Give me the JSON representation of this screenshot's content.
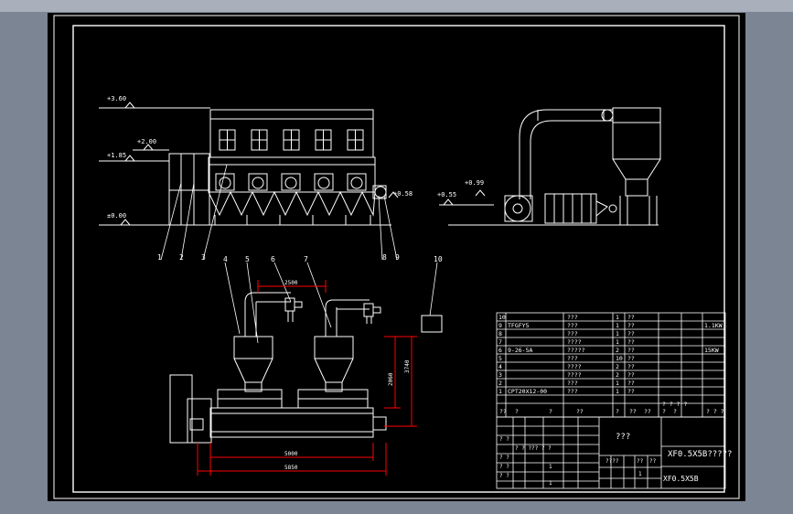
{
  "levels": {
    "l360": "+3.60",
    "l200": "+2.00",
    "l185": "+1.85",
    "l000": "±0.00",
    "l058": "+0.58",
    "l055": "+0.55",
    "l099": "+0.99"
  },
  "part_numbers": [
    "1",
    "2",
    "3",
    "4",
    "5",
    "6",
    "7",
    "8",
    "9",
    "10"
  ],
  "dimensions": {
    "top_span": "2500",
    "height_a": "3740",
    "height_b": "2060",
    "bottom_inner": "5000",
    "bottom_outer": "5850"
  },
  "parts_table": [
    {
      "no": "10",
      "code": "",
      "name": "???",
      "qty": "1",
      "mat": "??",
      "note": ""
    },
    {
      "no": "9",
      "code": "TFGFY5",
      "name": "???",
      "qty": "1",
      "mat": "??",
      "note": "1.1KW"
    },
    {
      "no": "8",
      "code": "",
      "name": "???",
      "qty": "1",
      "mat": "??",
      "note": ""
    },
    {
      "no": "7",
      "code": "",
      "name": "????",
      "qty": "1",
      "mat": "??",
      "note": ""
    },
    {
      "no": "6",
      "code": "9-26-5A",
      "name": "?????",
      "qty": "2",
      "mat": "??",
      "note": "15KW"
    },
    {
      "no": "5",
      "code": "",
      "name": "???",
      "qty": "10",
      "mat": "??",
      "note": ""
    },
    {
      "no": "4",
      "code": "",
      "name": "????",
      "qty": "2",
      "mat": "??",
      "note": ""
    },
    {
      "no": "3",
      "code": "",
      "name": "????",
      "qty": "2",
      "mat": "??",
      "note": ""
    },
    {
      "no": "2",
      "code": "",
      "name": "???",
      "qty": "1",
      "mat": "??",
      "note": ""
    },
    {
      "no": "1",
      "code": "CPT20X12-00",
      "name": "???",
      "qty": "1",
      "mat": "??",
      "note": ""
    }
  ],
  "table_header_row": [
    "??",
    "?",
    "?",
    "??",
    "?",
    "??",
    "??",
    "?",
    "?",
    "? ? ? ?",
    "? ? ?"
  ],
  "title_block": {
    "center": "???",
    "name": "XF0.5X5B?????",
    "drawing_no": "XF0.5X5B",
    "row_a": "? ?",
    "row_b": "? ? ??? ? ?",
    "row_c": "? ?",
    "row_d": "? ?",
    "row_e": "? ?",
    "cell_f": "????",
    "cell_g": "??",
    "cell_h": "??",
    "cell_i": "1",
    "cell_j": "1",
    "cell_k": "1"
  },
  "colors": {
    "background": "#7c8593",
    "sheet": "#000000",
    "line": "#ffffff",
    "dimension": "#ff0000",
    "leader": "#00ff00"
  }
}
